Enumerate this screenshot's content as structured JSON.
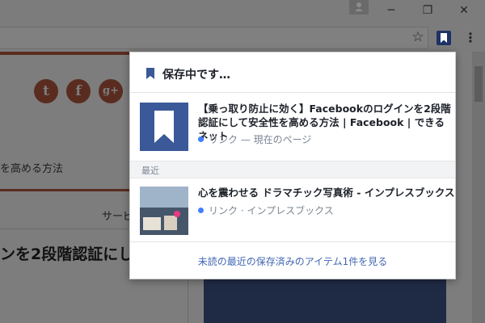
{
  "window": {
    "minimize_glyph": "─",
    "maximize_glyph": "❐",
    "close_glyph": "✕"
  },
  "toolbar": {
    "star_glyph": "☆",
    "menu_glyph": "⋮",
    "extension_icon": "facebook-save-bookmark-icon"
  },
  "page": {
    "social_buttons": [
      {
        "icon": "twitter-icon",
        "glyph": "t"
      },
      {
        "icon": "facebook-icon",
        "glyph": "f"
      },
      {
        "icon": "google-plus-icon",
        "glyph": "g+"
      }
    ],
    "caption": "を高める方法",
    "service": "サービ",
    "heading": "ンを2段階認証にし"
  },
  "popup": {
    "header_title": "保存中です…",
    "saved_item": {
      "title": "【乗っ取り防止に効く】Facebookのログインを2段階認証にして安全性を高める方法 | Facebook | できるネット",
      "meta": "リンク — 現在のページ"
    },
    "section_label": "最近",
    "recent_item": {
      "title": "心を震わせる ドラマチック写真術 - インプレスブックス",
      "meta": "リンク · インプレスブックス"
    },
    "footer_link": "未読の最近の保存済みのアイテム1件を見る"
  },
  "colors": {
    "facebook_blue": "#3b5998",
    "link_blue": "#4267b2",
    "dot_blue": "#4080ff",
    "extension_bg": "#1d3365"
  }
}
